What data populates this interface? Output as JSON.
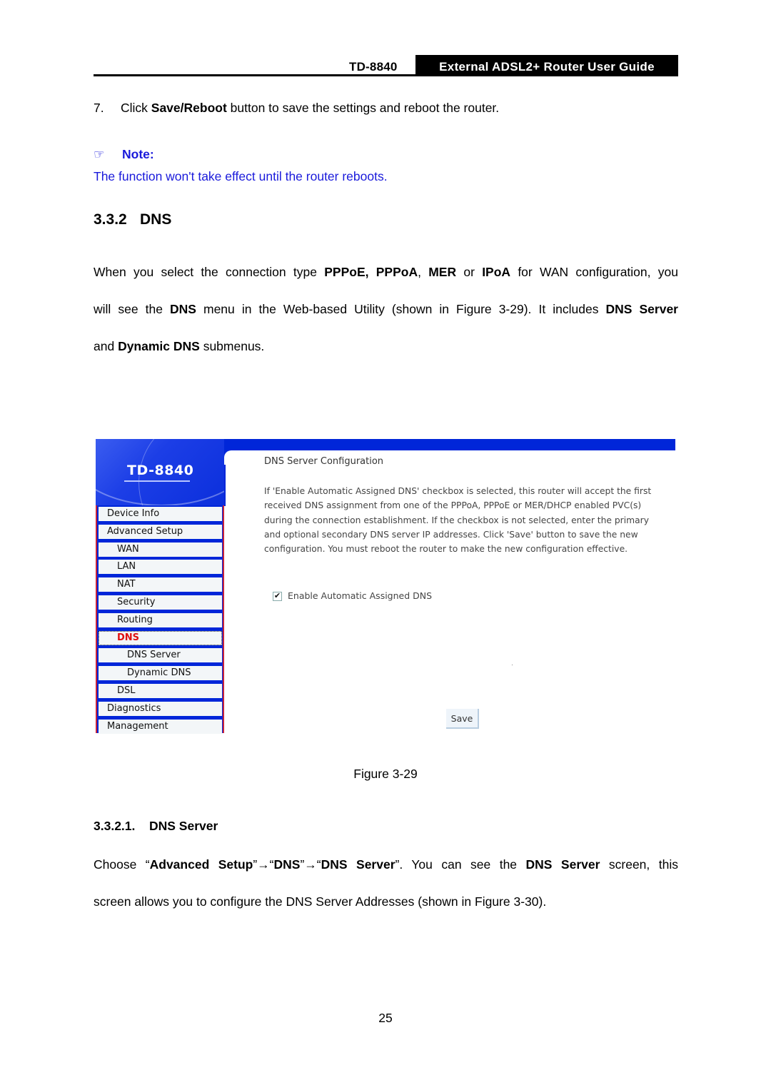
{
  "header": {
    "model": "TD-8840",
    "guide_title": "External ADSL2+ Router User Guide"
  },
  "step7": {
    "number": "7.",
    "pre": "Click ",
    "bold": "Save/Reboot",
    "post": " button to save the settings and reboot the router."
  },
  "note": {
    "icon": "pointing-hand-icon",
    "icon_glyph": "☞",
    "label": "Note:",
    "text": "The function won't take effect until the router reboots.",
    "color": "#1a1adb"
  },
  "section": {
    "number": "3.3.2",
    "title": "DNS"
  },
  "intro": {
    "line1": [
      "When you select the connection type ",
      "PPPoE, PPPoA",
      ", ",
      "MER",
      " or ",
      "IPoA",
      " for WAN configuration, you"
    ],
    "line2": [
      "will see the ",
      "DNS",
      " menu in the Web-based Utility (shown in Figure 3-29). It includes ",
      "DNS Server"
    ],
    "line3": [
      "and ",
      "Dynamic DNS",
      " submenus."
    ]
  },
  "figure": {
    "logo_text": "TD-8840",
    "menu": [
      {
        "label": "Device Info",
        "level": 0
      },
      {
        "label": "Advanced Setup",
        "level": 0
      },
      {
        "label": "WAN",
        "level": 1
      },
      {
        "label": "LAN",
        "level": 1
      },
      {
        "label": "NAT",
        "level": 1
      },
      {
        "label": "Security",
        "level": 1
      },
      {
        "label": "Routing",
        "level": 1
      },
      {
        "label": "DNS",
        "level": 1,
        "active": true
      },
      {
        "label": "DNS Server",
        "level": 2
      },
      {
        "label": "Dynamic DNS",
        "level": 2
      },
      {
        "label": "DSL",
        "level": 1
      },
      {
        "label": "Diagnostics",
        "level": 0
      },
      {
        "label": "Management",
        "level": 0
      }
    ],
    "config_title": "DNS Server Configuration",
    "config_description": "If 'Enable Automatic Assigned DNS' checkbox is selected, this router will accept the first received DNS assignment from one of the PPPoA, PPPoE or MER/DHCP enabled PVC(s) during the connection establishment. If the checkbox is not selected, enter the primary and optional secondary DNS server IP addresses. Click 'Save' button to save the new configuration. You must reboot the router to make the new configuration effective.",
    "checkbox_label": "Enable Automatic Assigned DNS",
    "checkbox_checked": true,
    "save_label": "Save",
    "colors": {
      "brand_blue": "#0026d9",
      "active_menu": "#e01010",
      "border_red": "#c8233a"
    }
  },
  "caption": "Figure 3-29",
  "subsection": {
    "number": "3.3.2.1.",
    "title": "DNS Server"
  },
  "choose": {
    "line1": [
      "Choose “",
      "Advanced Setup",
      "”→“",
      "DNS",
      "”→“",
      "DNS Server",
      "”. You can see the ",
      "DNS Server",
      " screen, this"
    ],
    "line2": "screen allows you to configure the DNS Server Addresses (shown in Figure 3-30)."
  },
  "page_number": "25"
}
